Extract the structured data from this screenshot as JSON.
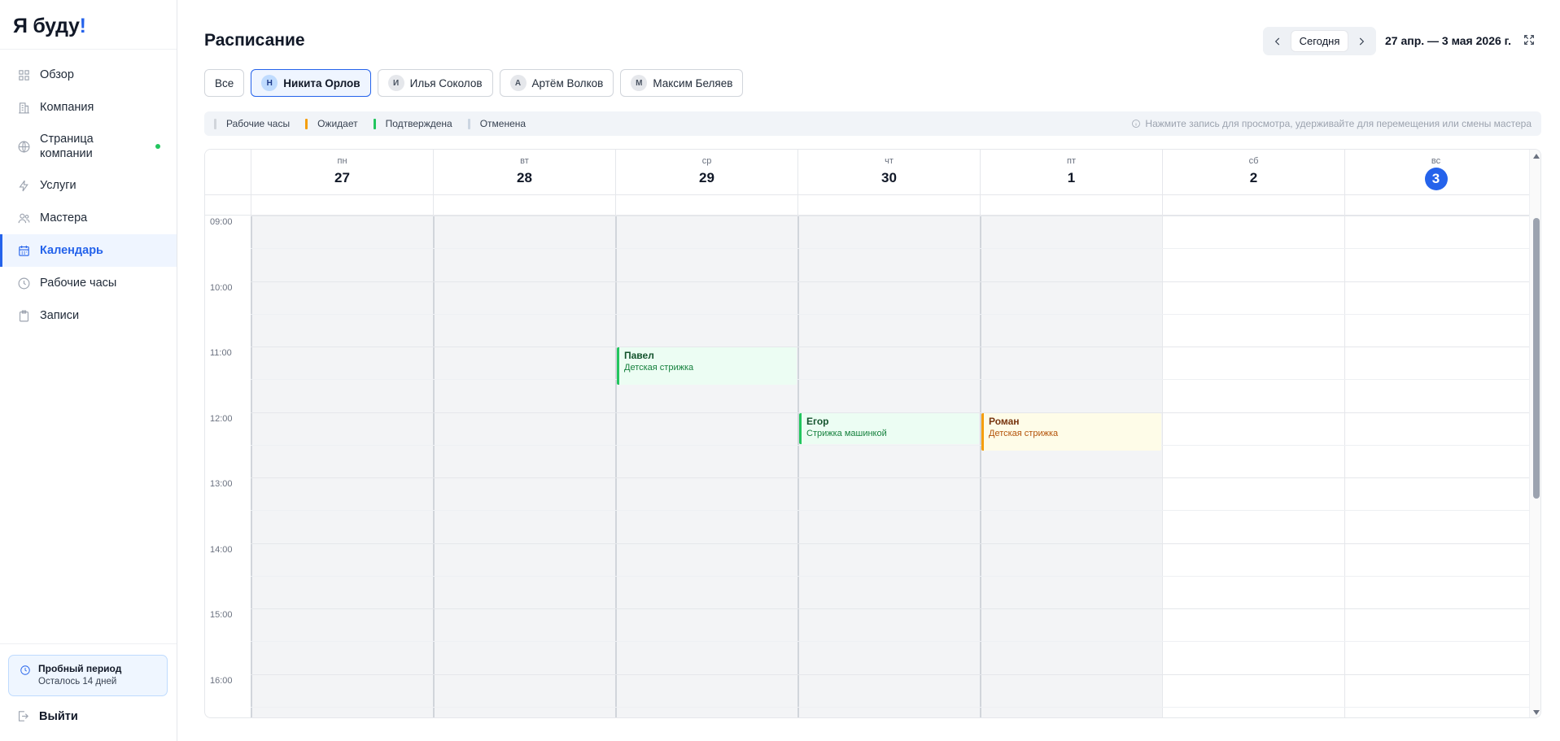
{
  "app": {
    "logo_text": "Я буду",
    "logo_accent": "!"
  },
  "sidebar": {
    "items": [
      {
        "label": "Обзор",
        "icon": "grid-icon",
        "active": false
      },
      {
        "label": "Компания",
        "icon": "building-icon",
        "active": false
      },
      {
        "label": "Страница компании",
        "icon": "globe-icon",
        "active": false,
        "status_dot": true
      },
      {
        "label": "Услуги",
        "icon": "lightning-icon",
        "active": false
      },
      {
        "label": "Мастера",
        "icon": "users-icon",
        "active": false
      },
      {
        "label": "Календарь",
        "icon": "calendar-icon",
        "active": true
      },
      {
        "label": "Рабочие часы",
        "icon": "clock-icon",
        "active": false
      },
      {
        "label": "Записи",
        "icon": "clipboard-icon",
        "active": false
      }
    ],
    "trial": {
      "title": "Пробный период",
      "subtitle": "Осталось 14 дней"
    },
    "logout_label": "Выйти"
  },
  "header": {
    "title": "Расписание",
    "today_label": "Сегодня",
    "date_range": "27 апр. — 3 мая 2026 г."
  },
  "filters": [
    {
      "label": "Все",
      "initial": "",
      "active": false
    },
    {
      "label": "Никита Орлов",
      "initial": "Н",
      "active": true
    },
    {
      "label": "Илья Соколов",
      "initial": "И",
      "active": false
    },
    {
      "label": "Артём Волков",
      "initial": "А",
      "active": false
    },
    {
      "label": "Максим Беляев",
      "initial": "М",
      "active": false
    }
  ],
  "legend": {
    "items": [
      {
        "label": "Рабочие часы",
        "color": "#d1d5db"
      },
      {
        "label": "Ожидает",
        "color": "#f59e0b"
      },
      {
        "label": "Подтверждена",
        "color": "#22c55e"
      },
      {
        "label": "Отменена",
        "color": "#cbd5e1"
      }
    ],
    "hint": "Нажмите запись для просмотра, удерживайте для перемещения или смены мастера"
  },
  "calendar": {
    "days": [
      {
        "dow": "пн",
        "num": "27",
        "today": false,
        "working": true
      },
      {
        "dow": "вт",
        "num": "28",
        "today": false,
        "working": true
      },
      {
        "dow": "ср",
        "num": "29",
        "today": false,
        "working": true
      },
      {
        "dow": "чт",
        "num": "30",
        "today": false,
        "working": true
      },
      {
        "dow": "пт",
        "num": "1",
        "today": false,
        "working": true
      },
      {
        "dow": "сб",
        "num": "2",
        "today": false,
        "working": false
      },
      {
        "dow": "вс",
        "num": "3",
        "today": true,
        "working": false
      }
    ],
    "hours": [
      "09:00",
      "10:00",
      "11:00",
      "12:00",
      "13:00",
      "14:00",
      "15:00",
      "16:00"
    ],
    "events": [
      {
        "day": 2,
        "start": 11.0,
        "end": 11.6,
        "name": "Павел",
        "service": "Детская стрижка",
        "status": "confirmed"
      },
      {
        "day": 3,
        "start": 12.0,
        "end": 12.5,
        "name": "Егор",
        "service": "Стрижка машинкой",
        "status": "confirmed"
      },
      {
        "day": 4,
        "start": 12.0,
        "end": 12.6,
        "name": "Роман",
        "service": "Детская стрижка",
        "status": "pending"
      }
    ]
  }
}
